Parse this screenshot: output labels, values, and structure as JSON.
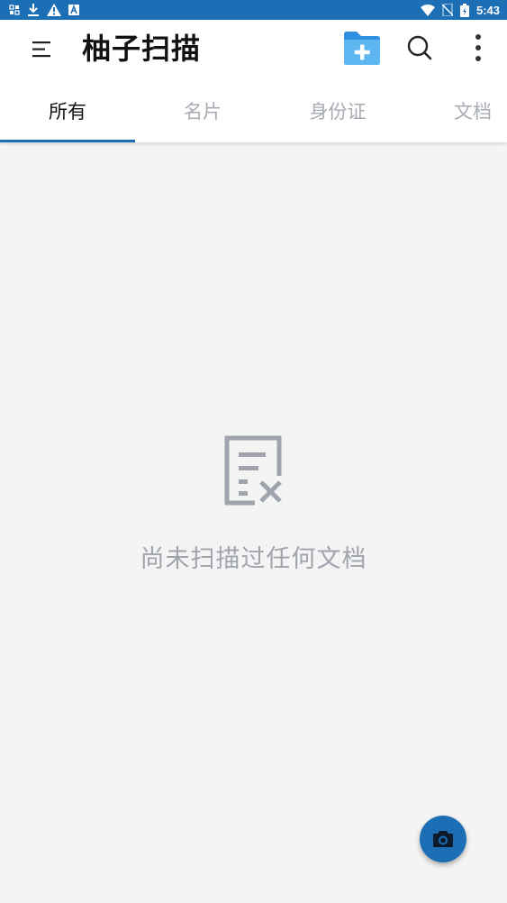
{
  "status_bar": {
    "time": "5:43",
    "left_icons": [
      "sim-notification-icon",
      "download-icon",
      "warning-icon",
      "a-icon"
    ],
    "right_icons": [
      "wifi-icon",
      "no-sim-icon",
      "battery-icon"
    ]
  },
  "app_bar": {
    "title": "柚子扫描",
    "actions": [
      "menu-icon",
      "new-folder-icon",
      "search-icon",
      "more-vert-icon"
    ]
  },
  "tabs": [
    {
      "label": "所有",
      "selected": true
    },
    {
      "label": "名片",
      "selected": false
    },
    {
      "label": "身份证",
      "selected": false
    },
    {
      "label": "文档",
      "selected": false
    }
  ],
  "empty_state": {
    "icon": "document-x-icon",
    "message": "尚未扫描过任何文档"
  },
  "fab": {
    "icon": "camera-icon"
  },
  "colors": {
    "primary": "#1d6fb5",
    "folder_light": "#5eb7f0",
    "folder_dark": "#2f8fe0",
    "background": "#f4f4f4",
    "inactive_text": "#a7abb3",
    "empty_icon": "#a0a4ad"
  }
}
